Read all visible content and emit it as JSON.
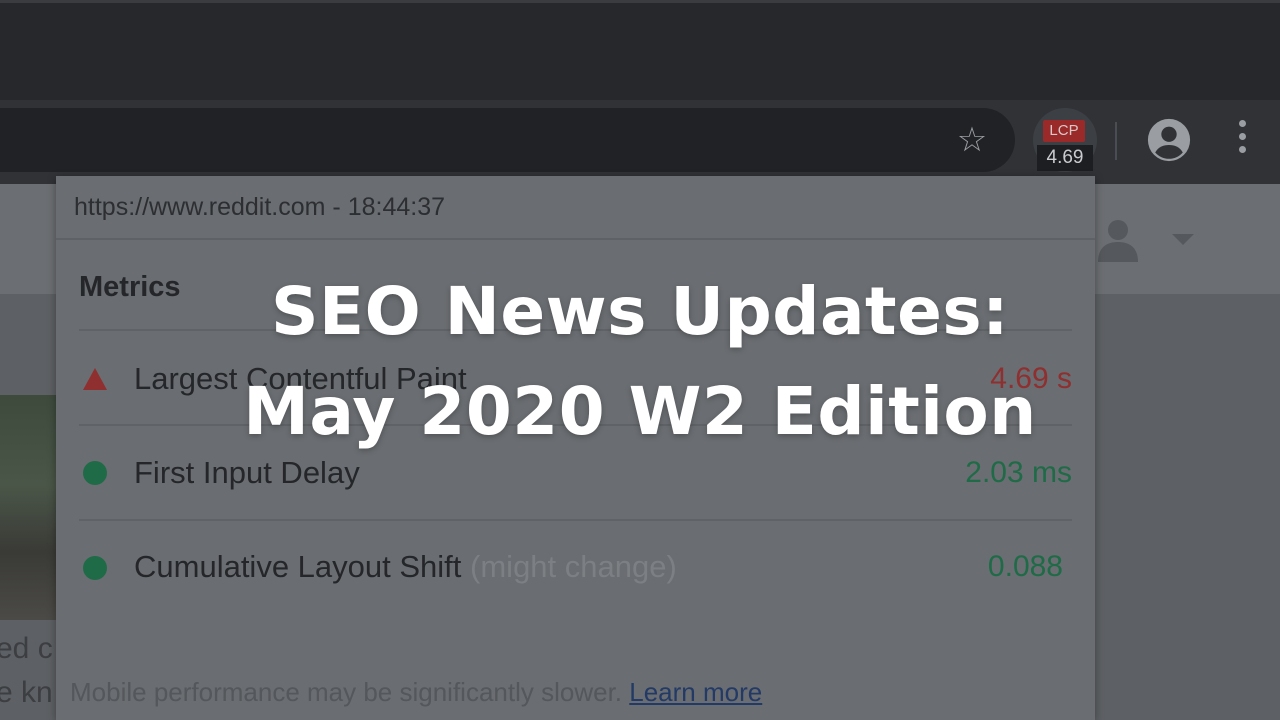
{
  "browser": {
    "extension_badge": {
      "label": "LCP",
      "value": "4.69"
    },
    "icons": [
      "star-icon",
      "account-circle-icon",
      "more-vert-icon"
    ]
  },
  "popup": {
    "url_line": "https://www.reddit.com - 18:44:37",
    "section_title": "Metrics",
    "metrics": [
      {
        "name": "Largest Contentful Paint",
        "note": "",
        "value": "4.69 s",
        "status": "poor",
        "icon": "warning-triangle-icon",
        "color": "#c0392b"
      },
      {
        "name": "First Input Delay",
        "note": "",
        "value": "2.03 ms",
        "status": "good",
        "icon": "green-dot-icon",
        "color": "#1e8e5a"
      },
      {
        "name": "Cumulative Layout Shift",
        "note": "(might change)",
        "value": "0.088",
        "status": "good",
        "icon": "green-dot-icon",
        "color": "#1e8e5a"
      }
    ],
    "footer_text": "Mobile performance may be significantly slower.",
    "footer_link": "Learn more"
  },
  "background_page": {
    "side_text_1": "ed c",
    "side_text_2": "e kn"
  },
  "overlay": {
    "line1": "SEO News Updates:",
    "line2": "May 2020 W2 Edition"
  }
}
